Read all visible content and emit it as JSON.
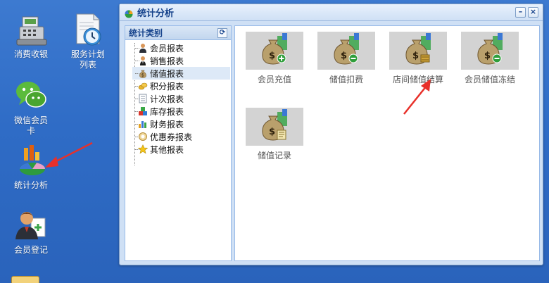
{
  "desktop": {
    "icons": [
      {
        "label": "消费收银"
      },
      {
        "label": "服务计划列表"
      },
      {
        "label": "微信会员卡"
      },
      {
        "label": "统计分析"
      },
      {
        "label": "会员登记"
      }
    ]
  },
  "window": {
    "title": "统计分析",
    "minimize": "–",
    "close": "×",
    "sidebar": {
      "title": "统计类别",
      "refresh": "⟳",
      "items": [
        {
          "label": "会员报表"
        },
        {
          "label": "销售报表"
        },
        {
          "label": "储值报表",
          "selected": true
        },
        {
          "label": "积分报表"
        },
        {
          "label": "计次报表"
        },
        {
          "label": "库存报表"
        },
        {
          "label": "财务报表"
        },
        {
          "label": "优惠券报表"
        },
        {
          "label": "其他报表"
        }
      ]
    },
    "tiles": [
      {
        "label": "会员充值",
        "icon": "money-bag-plus-icon"
      },
      {
        "label": "储值扣费",
        "icon": "money-bag-minus-icon"
      },
      {
        "label": "店间储值结算",
        "icon": "money-bag-transfer-icon"
      },
      {
        "label": "会员储值冻结",
        "icon": "money-bag-freeze-icon"
      },
      {
        "label": "储值记录",
        "icon": "money-bag-record-icon"
      }
    ]
  },
  "colors": {
    "desktop": "#2f6cc6",
    "arrow": "#e8302a",
    "title_text": "#15428b"
  }
}
